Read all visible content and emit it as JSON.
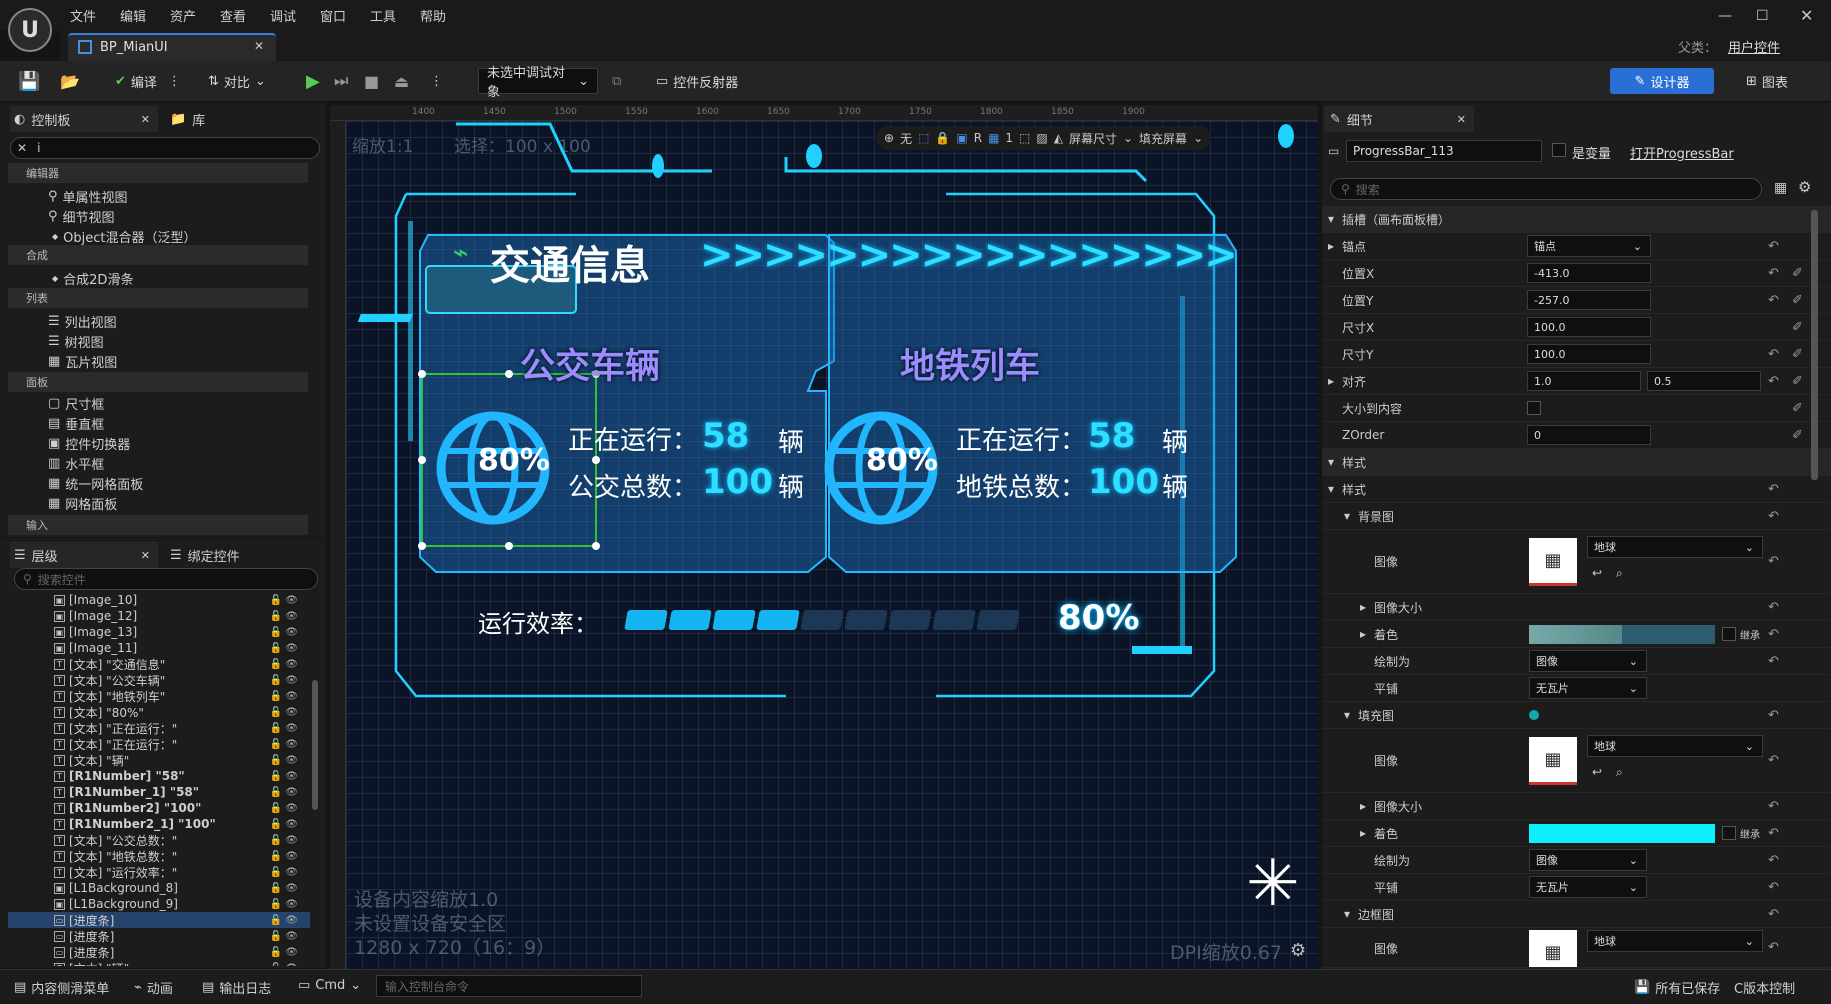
{
  "menu": [
    "文件",
    "编辑",
    "资产",
    "查看",
    "调试",
    "窗口",
    "工具",
    "帮助"
  ],
  "tab": {
    "title": "BP_MianUI"
  },
  "parent": {
    "label": "父类：",
    "value": "用户控件"
  },
  "toolbar": {
    "compile": "编译",
    "diff": "对比",
    "debug_object": "未选中调试对象",
    "reflector": "控件反射器",
    "designer": "设计器",
    "graph": "图表"
  },
  "palette": {
    "tab1": "控制板",
    "tab2": "库",
    "search_value": "i",
    "sections": [
      {
        "title": "编辑器",
        "items": [
          "单属性视图",
          "细节视图",
          "Object混合器（泛型）"
        ]
      },
      {
        "title": "合成",
        "items": [
          "合成2D滑条"
        ]
      },
      {
        "title": "列表",
        "items": [
          "列出视图",
          "树视图",
          "瓦片视图"
        ]
      },
      {
        "title": "面板",
        "items": [
          "尺寸框",
          "垂直框",
          "控件切换器",
          "水平框",
          "统一网格面板",
          "网格面板"
        ]
      },
      {
        "title": "输入",
        "items": []
      }
    ]
  },
  "hierarchy": {
    "tab1": "层级",
    "tab2": "绑定控件",
    "search_placeholder": "搜索控件",
    "items": [
      "[Image_10]",
      "[Image_12]",
      "[Image_13]",
      "[Image_11]",
      "[文本] \"交通信息\"",
      "[文本] \"公交车辆\"",
      "[文本] \"地铁列车\"",
      "[文本] \"80%\"",
      "[文本] \"正在运行：\"",
      "[文本] \"正在运行：\"",
      "[文本] \"辆\"",
      "[R1Number] \"58\"",
      "[R1Number_1] \"58\"",
      "[R1Number2] \"100\"",
      "[R1Number2_1] \"100\"",
      "[文本] \"公交总数：\"",
      "[文本] \"地铁总数：\"",
      "[文本] \"运行效率：\"",
      "[L1Background_8]",
      "[L1Background_9]",
      "[进度条]",
      "[进度条]",
      "[进度条]",
      "[文本] \"辆\""
    ],
    "selected_index": 20
  },
  "viewport": {
    "zoom": "缩放1:1",
    "selection": "选择：100 x 100",
    "ruler": [
      "1400",
      "1450",
      "1500",
      "1550",
      "1600",
      "1650",
      "1700",
      "1750",
      "1800",
      "1850",
      "1900"
    ],
    "toggle_none": "无",
    "toggle_r": "R",
    "grid_value": "1",
    "screen_size": "屏幕尺寸",
    "fill_screen": "填充屏幕",
    "info1": "设备内容缩放1.0",
    "info2": "未设置设备安全区",
    "info3": "1280 x 720（16：9）",
    "dpi": "DPI缩放0.67",
    "widget": {
      "title": "交通信息",
      "arrows": ">>>>>>>>>>>>>>>>>",
      "card1": {
        "title": "公交车辆",
        "percent": "80%",
        "running_label": "正在运行：",
        "running_value": "58",
        "unit": "辆",
        "total_label": "公交总数：",
        "total_value": "100"
      },
      "card2": {
        "title": "地铁列车",
        "percent": "80%",
        "running_label": "正在运行：",
        "running_value": "58",
        "unit": "辆",
        "total_label": "地铁总数：",
        "total_value": "100"
      },
      "efficiency_label": "运行效率：",
      "efficiency_value": "80%",
      "efficiency_fraction": 0.4
    }
  },
  "details": {
    "tab": "细节",
    "name": "ProgressBar_113",
    "is_variable": "是变量",
    "open_link": "打开ProgressBar",
    "search_placeholder": "搜索",
    "slot_section": "插槽（画布面板槽）",
    "anchor_label": "锚点",
    "anchor_value": "锚点",
    "posx_label": "位置X",
    "posx_value": "-413.0",
    "posy_label": "位置Y",
    "posy_value": "-257.0",
    "sizex_label": "尺寸X",
    "sizex_value": "100.0",
    "sizey_label": "尺寸Y",
    "sizey_value": "100.0",
    "align_label": "对齐",
    "align_x": "1.0",
    "align_y": "0.5",
    "size_to_content": "大小到内容",
    "zorder_label": "ZOrder",
    "zorder_value": "0",
    "style_section": "样式",
    "style_sub": "样式",
    "bg_image": "背景图",
    "image_label": "图像",
    "image_value": "地球",
    "image_size": "图像大小",
    "tint": "着色",
    "inherit": "继承",
    "draw_as": "绘制为",
    "draw_as_value": "图像",
    "tiling": "平铺",
    "tiling_value": "无瓦片",
    "fill_image": "填充图",
    "border_image": "边框图"
  },
  "statusbar": {
    "content_drawer": "内容侧滑菜单",
    "animation": "动画",
    "output_log": "输出日志",
    "cmd": "Cmd",
    "cmd_placeholder": "输入控制台命令",
    "saved": "所有已保存",
    "source_control": "C版本控制"
  },
  "colors": {
    "accent": "#2ee0ff",
    "designer_btn": "#2a6fd6",
    "selection": "#31c331"
  }
}
